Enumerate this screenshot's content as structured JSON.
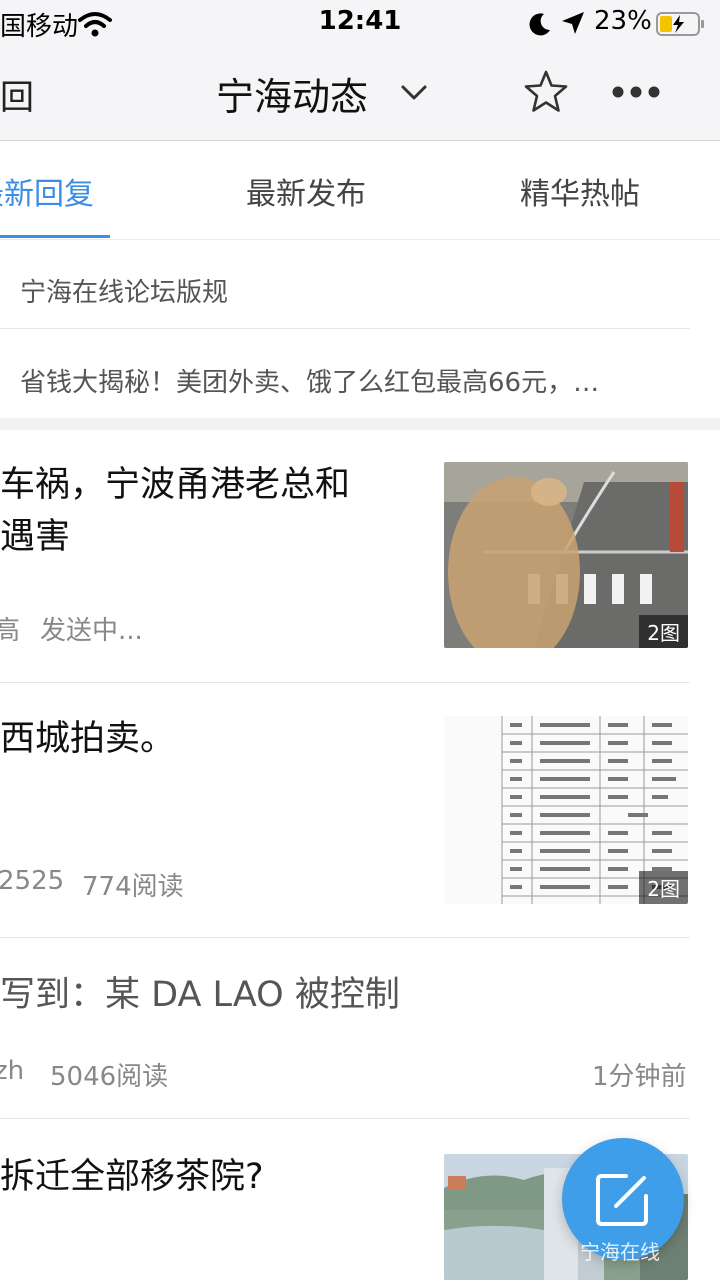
{
  "status_bar": {
    "carrier": "国移动",
    "time": "12:41",
    "battery": "23%",
    "icons": [
      "wifi-icon",
      "moon-icon",
      "location-arrow-icon",
      "battery-charging-icon"
    ]
  },
  "nav": {
    "back_label": "回",
    "title": "宁海动态",
    "icons": [
      "chevron-down-icon",
      "star-icon",
      "more-icon"
    ]
  },
  "tabs": [
    {
      "label": "最新回复",
      "active": true
    },
    {
      "label": "最新发布",
      "active": false
    },
    {
      "label": "精华热帖",
      "active": false
    }
  ],
  "notices": [
    "宁海在线论坛版规",
    "省钱大揭秘！美团外卖、饿了么红包最高66元，…"
  ],
  "feed": [
    {
      "title_line1": "车祸，宁波甬港老总和",
      "title_line2": "遇害",
      "author": "高",
      "status": "发送中...",
      "image_badge": "2图"
    },
    {
      "title_line1": "西城拍卖。",
      "author": "2525",
      "reads": "774阅读",
      "image_badge": "2图"
    },
    {
      "title_line1": "写到：某 DA LAO 被控制",
      "author": "zh",
      "reads": "5046阅读",
      "time": "1分钟前"
    },
    {
      "title_line1": "拆迁全部移茶院?"
    }
  ],
  "fab": {
    "icon": "compose-icon"
  },
  "watermark": "宁海在线",
  "colors": {
    "accent": "#3a8ee6",
    "fab": "#3f9ee9"
  }
}
